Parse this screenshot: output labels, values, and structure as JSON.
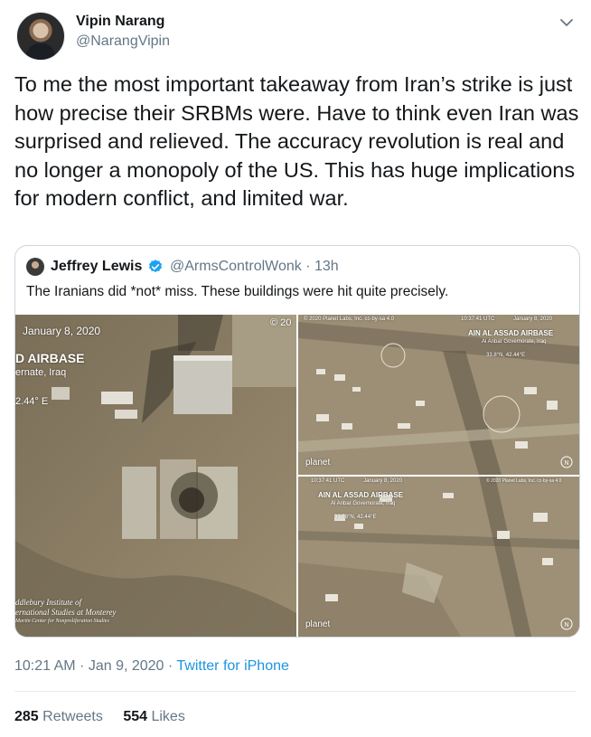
{
  "author": {
    "name": "Vipin Narang",
    "handle": "@NarangVipin"
  },
  "tweet": {
    "text": "To me the most important takeaway from Iran’s strike is just how precise their SRBMs were. Have to think even Iran was surprised and relieved. The accuracy revolution is real and no longer a monopoly of the US. This has huge implications for modern conflict, and limited war.",
    "time": "10:21 AM",
    "date_sep": " · ",
    "date": "Jan 9, 2020",
    "source_sep": " · ",
    "source": "Twitter for iPhone",
    "retweets": "285",
    "retweets_label": "Retweets",
    "likes": "554",
    "likes_label": "Likes"
  },
  "quoted": {
    "name": "Jeffrey Lewis",
    "handle_time": "@ArmsControlWonk · 13h",
    "text": "The Iranians did *not* miss. These buildings were hit quite precisely."
  },
  "images": {
    "left": {
      "date": "January 8, 2020",
      "corner": "© 20",
      "title": "D AIRBASE",
      "sub": "ernate, Iraq",
      "coord": "2.44° E",
      "credit1": "ddlebury Institute of",
      "credit2": "ernational Studies at Monterey",
      "credit3": "Martin Center for Nonproliferation Studies"
    },
    "top_right": {
      "copyright": "© 2020 Planet Labs, Inc. cc-by-sa 4.0",
      "time": "10:37:41 UTC",
      "date": "January 8, 2020",
      "title": "AIN AL ASSAD AIRBASE",
      "sub": "Al Anbar Governorate, Iraq",
      "coord": "33.8°N, 42.44°E",
      "logo": "planet"
    },
    "bottom_right": {
      "time": "10:37:41 UTC",
      "date": "January 8, 2020",
      "copyright": "© 2020 Planet Labs, Inc. cc-by-sa 4.0",
      "title": "AIN AL ASSAD AIRBASE",
      "sub": "Al Anbar Governorate, Iraq",
      "coord": "33.78°N, 42.44°E",
      "logo": "planet"
    }
  },
  "colors": {
    "link": "#1b95e0",
    "muted": "#657786",
    "text": "#14171a",
    "border": "#ccd6dd",
    "verified": "#1da1f2"
  },
  "icons": [
    "chevron-down-icon",
    "verified-badge-icon",
    "north-arrow-icon"
  ]
}
